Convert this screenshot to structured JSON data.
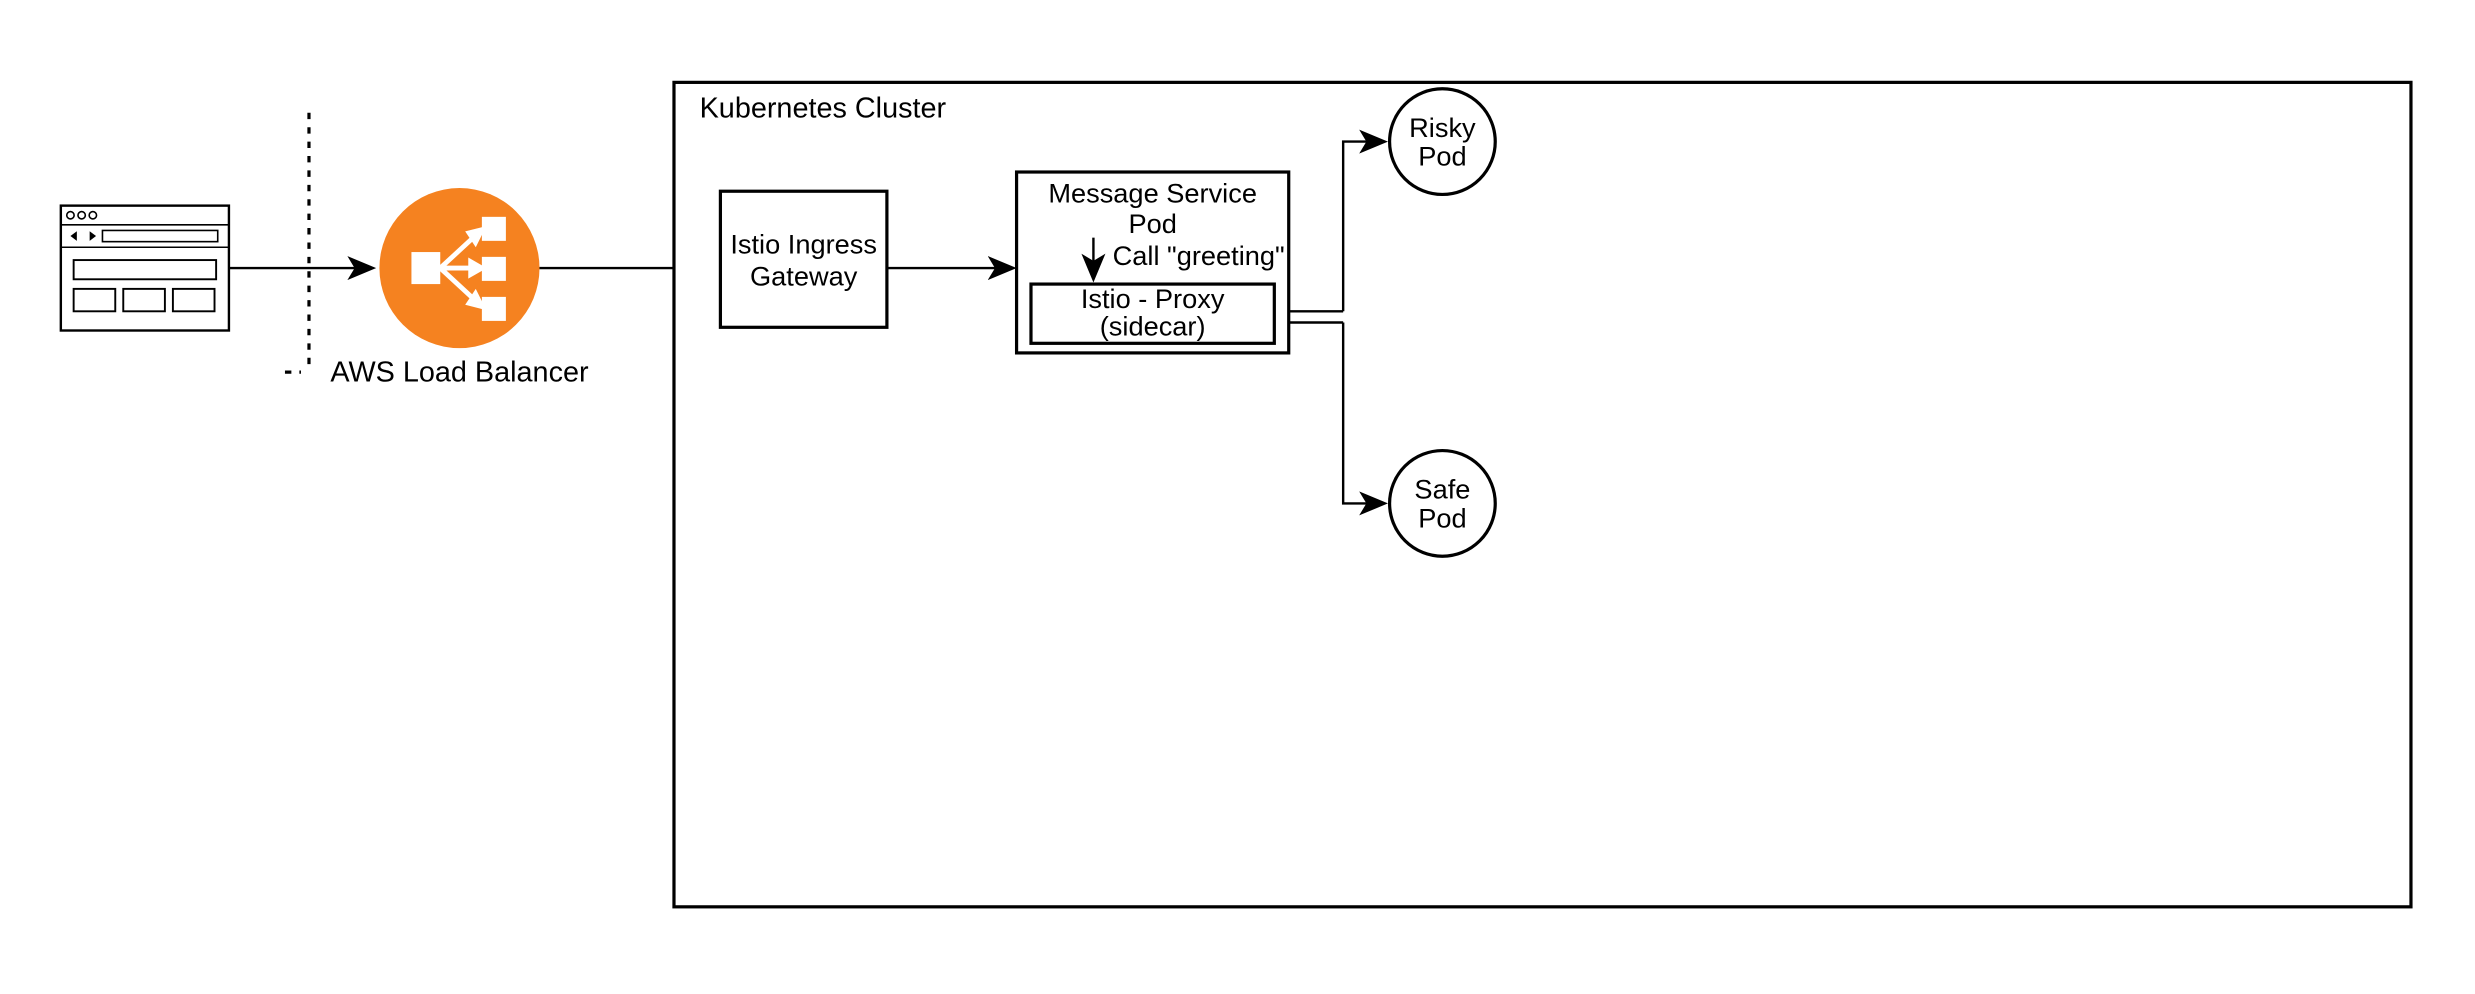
{
  "diagram": {
    "aws_lb_label": "AWS Load Balancer",
    "cluster_label": "Kubernetes Cluster",
    "ingress_label_line1": "Istio Ingress",
    "ingress_label_line2": "Gateway",
    "msg_pod_label_line1": "Message Service",
    "msg_pod_label_line2": "Pod",
    "call_label": "Call \"greeting\"",
    "sidecar_label_line1": "Istio - Proxy",
    "sidecar_label_line2": "(sidecar)",
    "risky_pod_label_line1": "Risky",
    "risky_pod_label_line2": "Pod",
    "safe_pod_label_line1": "Safe",
    "safe_pod_label_line2": "Pod"
  }
}
